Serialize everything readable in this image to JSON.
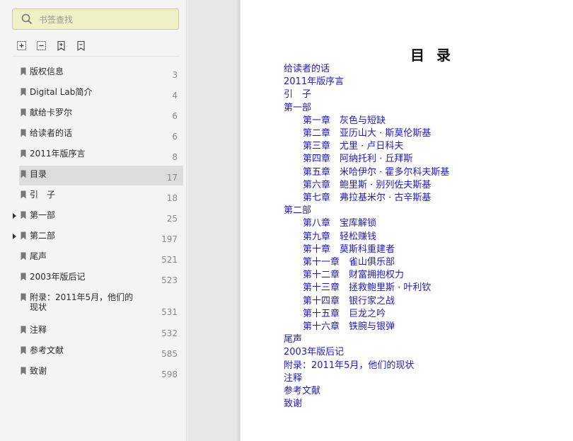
{
  "sidebar": {
    "search_placeholder": "书签查找",
    "toolbar": [
      {
        "icon": "expand-all-icon"
      },
      {
        "icon": "collapse-all-icon"
      },
      {
        "icon": "add-bookmark-icon"
      },
      {
        "icon": "bookmark-icon"
      }
    ],
    "bookmarks": [
      {
        "title": "版权信息",
        "page": "3"
      },
      {
        "title": "Digital Lab简介",
        "page": "4"
      },
      {
        "title": "献给卡罗尔",
        "page": "6"
      },
      {
        "title": "给读者的话",
        "page": "6"
      },
      {
        "title": "2011年版序言",
        "page": "8"
      },
      {
        "title": "目录",
        "page": "17",
        "active": true
      },
      {
        "title": "引　子",
        "page": "18"
      },
      {
        "title": "第一部",
        "page": "25",
        "expandable": true
      },
      {
        "title": "第二部",
        "page": "197",
        "expandable": true
      },
      {
        "title": "尾声",
        "page": "521"
      },
      {
        "title": "2003年版后记",
        "page": "523"
      },
      {
        "title": "附录：2011年5月，他们的现状",
        "page": "531",
        "wrap": true
      },
      {
        "title": "注释",
        "page": "532"
      },
      {
        "title": "参考文献",
        "page": "585"
      },
      {
        "title": "致谢",
        "page": "598"
      }
    ]
  },
  "document": {
    "toc_title": "目 录",
    "entries": [
      {
        "text": "给读者的话",
        "level": 1
      },
      {
        "text": "2011年版序言",
        "level": 1
      },
      {
        "text": "引　子",
        "level": 1
      },
      {
        "text": "第一部",
        "level": 1
      },
      {
        "text": "第一章　灰色与短缺",
        "level": 2
      },
      {
        "text": "第二章　亚历山大 · 斯莫伦斯基",
        "level": 2
      },
      {
        "text": "第三章　尤里 · 卢日科夫",
        "level": 2
      },
      {
        "text": "第四章　阿纳托利 · 丘拜斯",
        "level": 2
      },
      {
        "text": "第五章　米哈伊尔 · 霍多尔科夫斯基",
        "level": 2
      },
      {
        "text": "第六章　鲍里斯 · 别列佐夫斯基",
        "level": 2
      },
      {
        "text": "第七章　弗拉基米尔 · 古辛斯基",
        "level": 2
      },
      {
        "text": "第二部",
        "level": 1
      },
      {
        "text": "第八章　宝库解锁",
        "level": 2
      },
      {
        "text": "第九章　轻松赚钱",
        "level": 2
      },
      {
        "text": "第十章　莫斯科重建者",
        "level": 2
      },
      {
        "text": "第十一章　雀山俱乐部",
        "level": 2
      },
      {
        "text": "第十二章　财富拥抱权力",
        "level": 2
      },
      {
        "text": "第十三章　拯救鲍里斯 · 叶利钦",
        "level": 2
      },
      {
        "text": "第十四章　银行家之战",
        "level": 2
      },
      {
        "text": "第十五章　巨龙之吟",
        "level": 2
      },
      {
        "text": "第十六章　铁腕与银弹",
        "level": 2
      },
      {
        "text": "尾声",
        "level": 1
      },
      {
        "text": "2003年版后记",
        "level": 1
      },
      {
        "text": "附录：2011年5月，他们的现状",
        "level": 1
      },
      {
        "text": "注释",
        "level": 1
      },
      {
        "text": "参考文献",
        "level": 1
      },
      {
        "text": "致谢",
        "level": 1
      }
    ]
  },
  "colors": {
    "link": "#1a1ad6",
    "sidebar_bg": "#f4f4f4",
    "search_bg": "#eef0c8",
    "active_row": "#dcdcdc"
  }
}
